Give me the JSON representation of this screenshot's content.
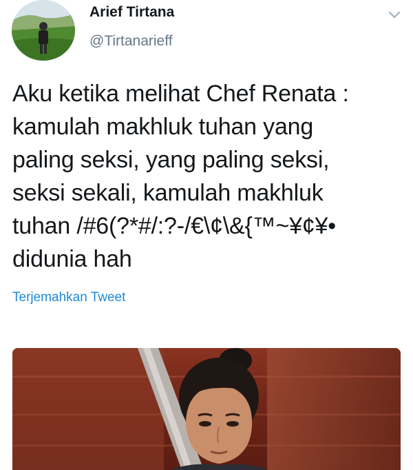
{
  "tweet": {
    "author": {
      "display_name": "Arief Tirtana",
      "handle": "@Tirtanarieff",
      "avatar_icon": "profile-photo"
    },
    "menu_icon": "chevron-down-icon",
    "text": "Aku ketika melihat Chef Renata :\nkamulah makhluk tuhan yang\npaling seksi, yang paling seksi,\nseksi sekali, kamulah makhluk\ntuhan /#6(?*#/:?-/€\\¢\\&{™~¥¢¥•\ndidunia hah",
    "translate_label": "Terjemahkan Tweet",
    "media": {
      "kind": "photo"
    }
  },
  "colors": {
    "text": "#14171a",
    "secondary": "#657786",
    "link": "#1d8ad8",
    "background": "#ffffff"
  }
}
